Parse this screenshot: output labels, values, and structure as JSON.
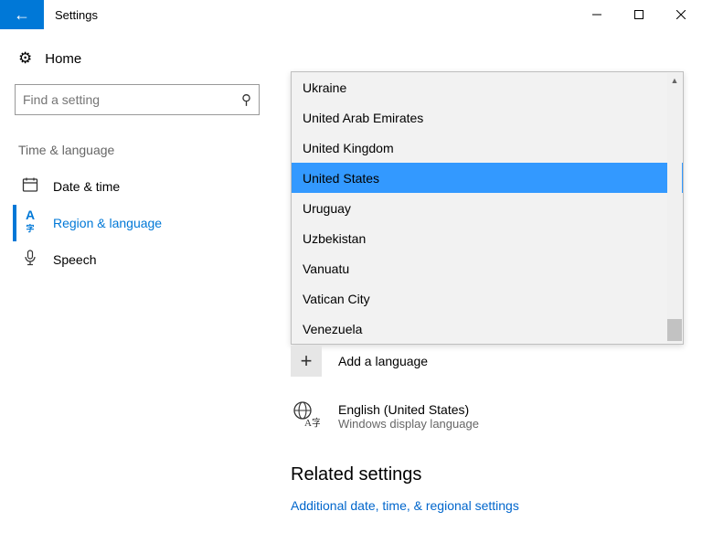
{
  "window": {
    "title": "Settings"
  },
  "sidebar": {
    "home": "Home",
    "searchPlaceholder": "Find a setting",
    "group": "Time & language",
    "items": [
      {
        "label": "Date & time"
      },
      {
        "label": "Region & language"
      },
      {
        "label": "Speech"
      }
    ],
    "activeIndex": 1
  },
  "dropdown": {
    "items": [
      "Ukraine",
      "United Arab Emirates",
      "United Kingdom",
      "United States",
      "Uruguay",
      "Uzbekistan",
      "Vanuatu",
      "Vatican City",
      "Venezuela"
    ],
    "selectedIndex": 3
  },
  "addLanguage": "Add a language",
  "currentLanguage": {
    "name": "English (United States)",
    "status": "Windows display language"
  },
  "related": {
    "heading": "Related settings",
    "link": "Additional date, time, & regional settings"
  }
}
